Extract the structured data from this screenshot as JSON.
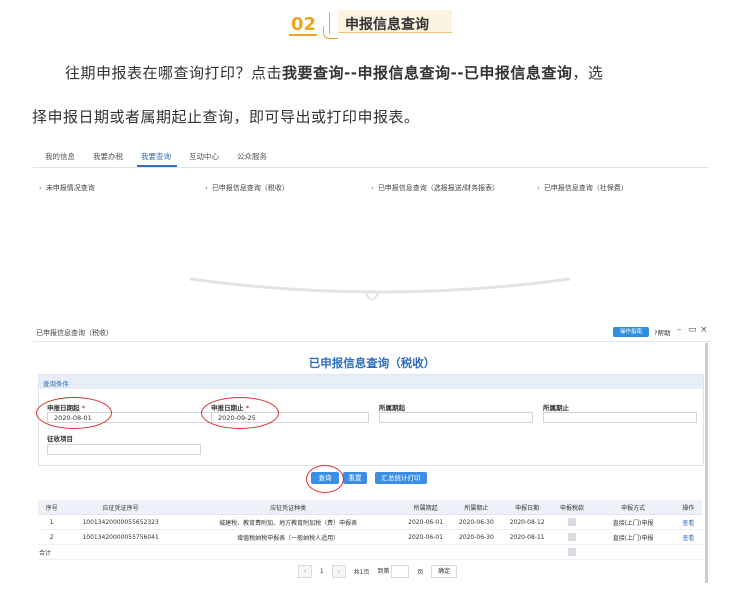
{
  "section": {
    "number": "02",
    "title": "申报信息查询"
  },
  "paragraph": {
    "line1_prefix": "往期申报表在哪查询打印？点击",
    "line1_bold": "我要查询--申报信息查询--已申报信息查询",
    "line1_suffix": "，选",
    "line2": "择申报日期或者属期起止查询，即可导出或打印申报表。"
  },
  "nav": {
    "tabs": [
      "我的信息",
      "我要办税",
      "我要查询",
      "互动中心",
      "公众服务"
    ],
    "active_tab": "我要查询",
    "menu_items": [
      "未申报情况查询",
      "已申报信息查询（税收）",
      "已申报信息查询（选报报送/财务报表）",
      "已申报信息查询（社保费）"
    ]
  },
  "window": {
    "title": "已申报信息查询（税收）",
    "help_button": "操作指南",
    "help_link": "?帮助",
    "page_title": "已申报信息查询（税收）",
    "conditions_label": "查询条件",
    "fields": {
      "apply_start_label": "申报日期起",
      "apply_start_value": "2020-08-01",
      "apply_end_label": "申报日期止",
      "apply_end_value": "2020-09-25",
      "period_start_label": "所属期起",
      "period_end_label": "所属期止",
      "tax_item_label": "征收项目"
    },
    "buttons": {
      "query": "查询",
      "reset": "重置",
      "print": "汇总统计打印"
    },
    "table": {
      "headers": [
        "序号",
        "应征凭证序号",
        "应征凭证种类",
        "所属期起",
        "所属期止",
        "申报日期",
        "申报税款",
        "申报方式",
        "操作"
      ],
      "rows": [
        [
          "1",
          "10013420000055652323",
          "城建税、教育费附加、地方教育附加税（费）申报表",
          "2020-06-01",
          "2020-06-30",
          "2020-08-12",
          "",
          "直接(上门)申报",
          "查看"
        ],
        [
          "2",
          "10013420000055756041",
          "增值税纳税申报表（一般纳税人适用）",
          "2020-06-01",
          "2020-06-30",
          "2020-08-11",
          "",
          "直接(上门)申报",
          "查看"
        ]
      ],
      "total_label": "合计"
    },
    "pager": {
      "prev": "‹",
      "page": "1",
      "next": "›",
      "total": "共1页",
      "goto": "到第",
      "unit": "页",
      "confirm": "确定"
    }
  }
}
